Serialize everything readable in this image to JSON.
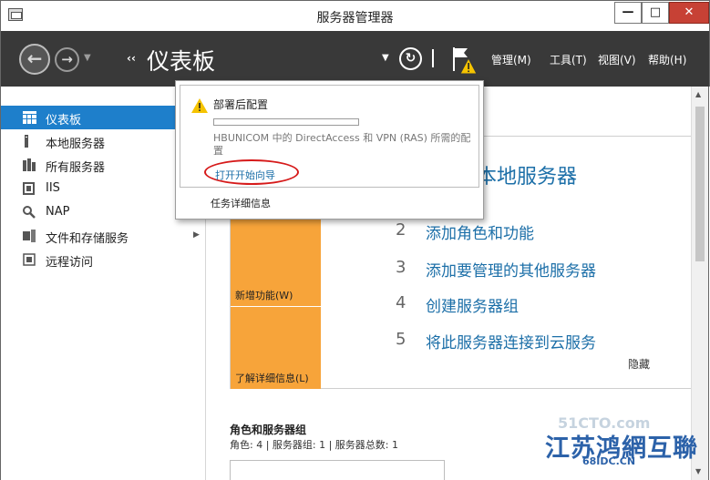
{
  "window": {
    "title": "服务器管理器",
    "min_glyph": "—",
    "max_glyph": "□",
    "close_glyph": "✕"
  },
  "toolbar": {
    "back_glyph": "←",
    "forward_glyph": "→",
    "dropdown_glyph": "▼",
    "breadcrumb_arrows": "‹‹",
    "breadcrumb_title": "仪表板",
    "refresh_glyph": "↻",
    "menus": [
      "管理(M)",
      "工具(T)",
      "视图(V)",
      "帮助(H)"
    ]
  },
  "sidebar": {
    "items": [
      {
        "label": "仪表板",
        "icon": "dashboard-icon",
        "active": true
      },
      {
        "label": "本地服务器",
        "icon": "local-server-icon"
      },
      {
        "label": "所有服务器",
        "icon": "all-servers-icon"
      },
      {
        "label": "IIS",
        "icon": "iis-icon"
      },
      {
        "label": "NAP",
        "icon": "nap-icon"
      },
      {
        "label": "文件和存储服务",
        "icon": "file-storage-icon",
        "has_arrow": true
      },
      {
        "label": "远程访问",
        "icon": "remote-access-icon"
      }
    ],
    "expand_arrow": "▶"
  },
  "welcome": {
    "title": "本地服务器",
    "steps": [
      {
        "num": "2",
        "label": "添加角色和功能"
      },
      {
        "num": "3",
        "label": "添加要管理的其他服务器"
      },
      {
        "num": "4",
        "label": "创建服务器组"
      },
      {
        "num": "5",
        "label": "将此服务器连接到云服务"
      }
    ],
    "new_features": "新增功能(W)",
    "learn_more": "了解详细信息(L)",
    "hide": "隐藏"
  },
  "roles": {
    "title": "角色和服务器组",
    "summary": "角色: 4 | 服务器组: 1 | 服务器总数: 1"
  },
  "notification": {
    "title": "部署后配置",
    "progress": 0.0,
    "message": "HBUNICOM 中的 DirectAccess 和 VPN (RAS) 所需的配置",
    "link": "打开开始向导",
    "task_details": "任务详细信息"
  },
  "scrollbar": {
    "up_glyph": "▲",
    "down_glyph": "▼"
  },
  "watermark": {
    "line1": "51CTO.com",
    "line2": "江苏鸿網互聯",
    "line3": "68IDC.CN"
  },
  "colors": {
    "accent": "#1e7fcb",
    "toolbar_bg": "#393939",
    "tile_orange": "#f7a43a",
    "link_blue": "#1c6fa8",
    "highlight_red": "#d61a1a"
  }
}
